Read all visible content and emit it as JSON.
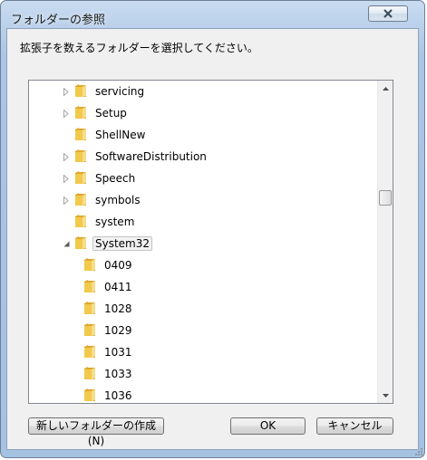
{
  "dialog": {
    "title": "フォルダーの参照",
    "instruction": "拡張子を数えるフォルダーを選択してください。"
  },
  "tree": {
    "items": [
      {
        "label": "servicing",
        "expander": "collapsed",
        "level": 0
      },
      {
        "label": "Setup",
        "expander": "collapsed",
        "level": 0
      },
      {
        "label": "ShellNew",
        "expander": "none",
        "level": 0
      },
      {
        "label": "SoftwareDistribution",
        "expander": "collapsed",
        "level": 0
      },
      {
        "label": "Speech",
        "expander": "collapsed",
        "level": 0
      },
      {
        "label": "symbols",
        "expander": "collapsed",
        "level": 0
      },
      {
        "label": "system",
        "expander": "none",
        "level": 0
      },
      {
        "label": "System32",
        "expander": "expanded",
        "level": 0,
        "selected": true
      },
      {
        "label": "0409",
        "expander": "none",
        "level": 1
      },
      {
        "label": "0411",
        "expander": "none",
        "level": 1
      },
      {
        "label": "1028",
        "expander": "none",
        "level": 1
      },
      {
        "label": "1029",
        "expander": "none",
        "level": 1
      },
      {
        "label": "1031",
        "expander": "none",
        "level": 1
      },
      {
        "label": "1033",
        "expander": "none",
        "level": 1
      },
      {
        "label": "1036",
        "expander": "none",
        "level": 1
      }
    ]
  },
  "buttons": {
    "new_folder": "新しいフォルダーの作成(N)",
    "ok": "OK",
    "cancel": "キャンセル"
  },
  "colors": {
    "folder": "#f2c94c",
    "frame": "#a5c2e3",
    "selection": "#f2f2f2"
  }
}
